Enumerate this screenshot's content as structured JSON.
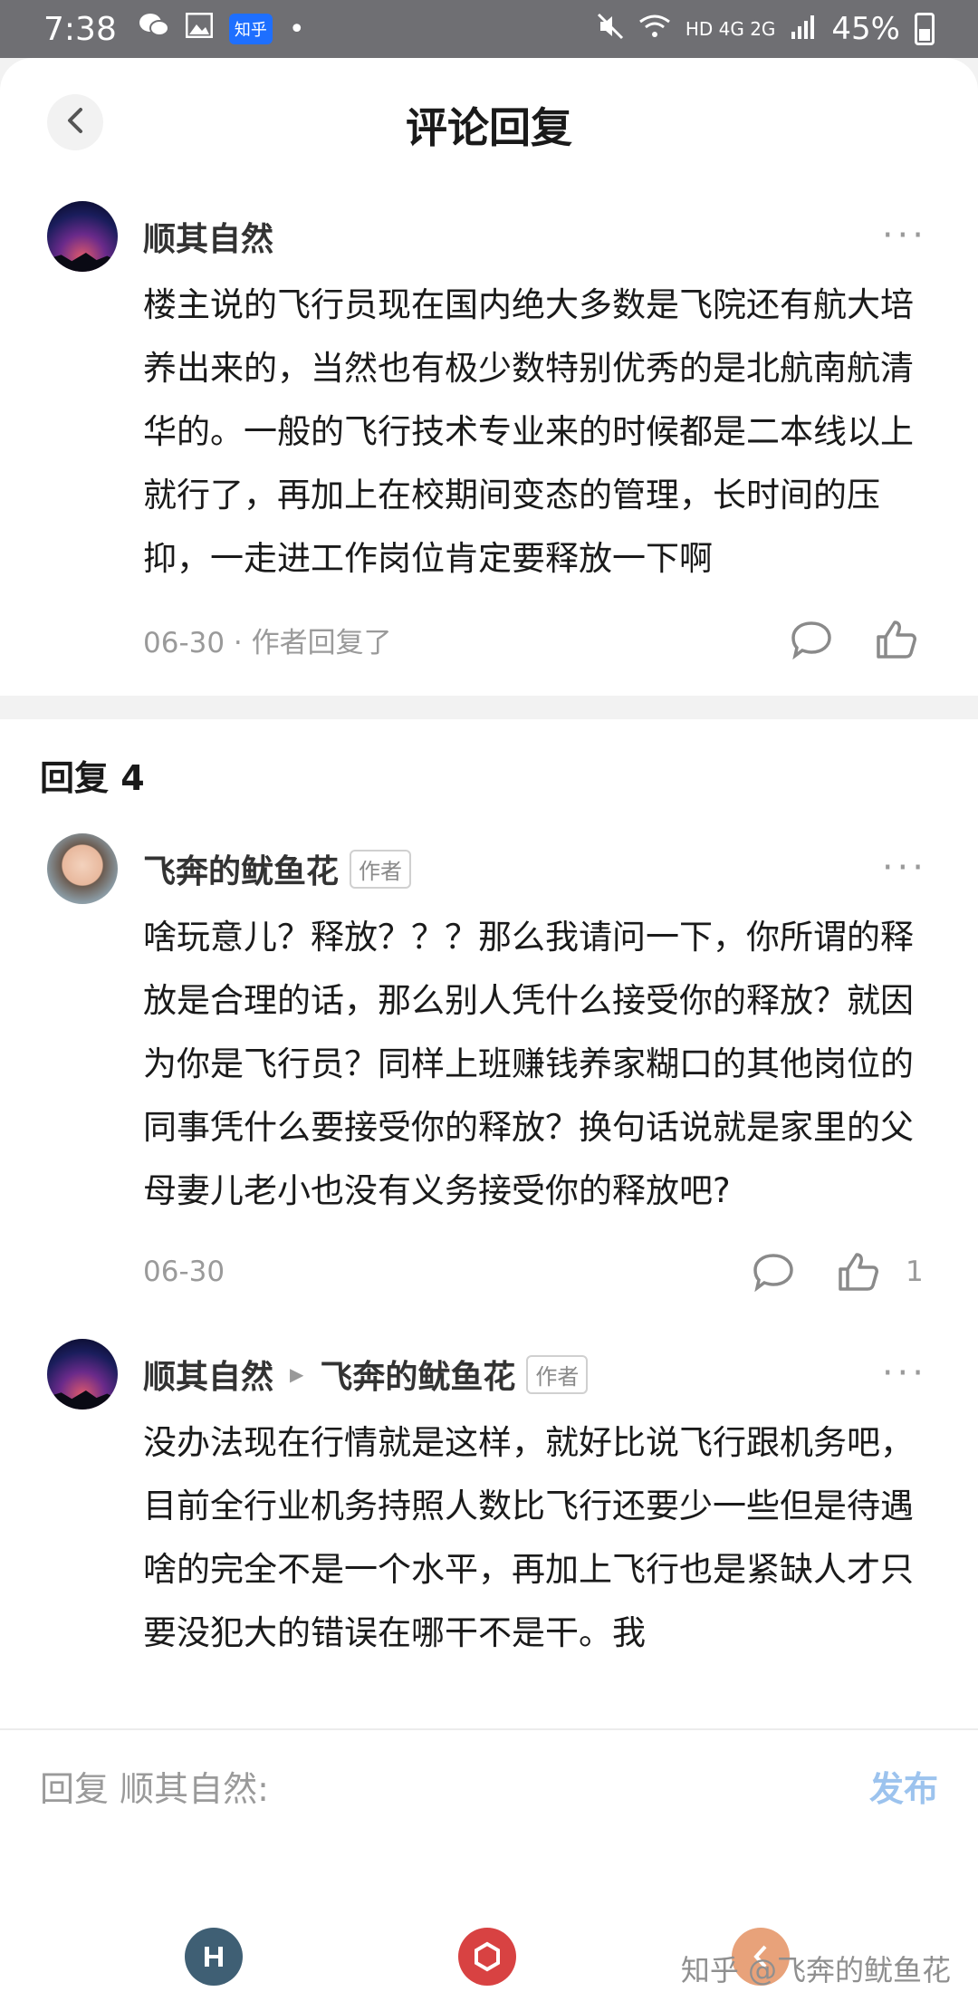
{
  "status_bar": {
    "time": "7:38",
    "app_badge": "知乎",
    "network": "HD 4G 2G",
    "battery": "45%"
  },
  "header": {
    "title": "评论回复"
  },
  "main_comment": {
    "author": "顺其自然",
    "text": "楼主说的飞行员现在国内绝大多数是飞院还有航大培养出来的，当然也有极少数特别优秀的是北航南航清华的。一般的飞行技术专业来的时候都是二本线以上就行了，再加上在校期间变态的管理，长时间的压抑，一走进工作岗位肯定要释放一下啊",
    "meta": "06-30 · 作者回复了"
  },
  "replies_header": "回复 4",
  "replies": [
    {
      "author": "飞奔的鱿鱼花",
      "tag": "作者",
      "text": "啥玩意儿？释放？？？那么我请问一下，你所谓的释放是合理的话，那么别人凭什么接受你的释放？就因为你是飞行员？同样上班赚钱养家糊口的其他岗位的同事凭什么要接受你的释放？换句话说就是家里的父母妻儿老小也没有义务接受你的释放吧?",
      "date": "06-30",
      "likes": "1"
    },
    {
      "author": "顺其自然",
      "reply_to": "飞奔的鱿鱼花",
      "tag": "作者",
      "text": "没办法现在行情就是这样，就好比说飞行跟机务吧，目前全行业机务持照人数比飞行还要少一些但是待遇啥的完全不是一个水平，再加上飞行也是紧缺人才只要没犯大的错误在哪干不是干。我"
    }
  ],
  "reply_bar": {
    "placeholder": "回复 顺其自然:",
    "publish": "发布"
  },
  "watermark": "知乎 @飞奔的鱿鱼花",
  "colors": {
    "accent_disabled": "#9cc3ee",
    "text_secondary": "#9a9a9a"
  }
}
